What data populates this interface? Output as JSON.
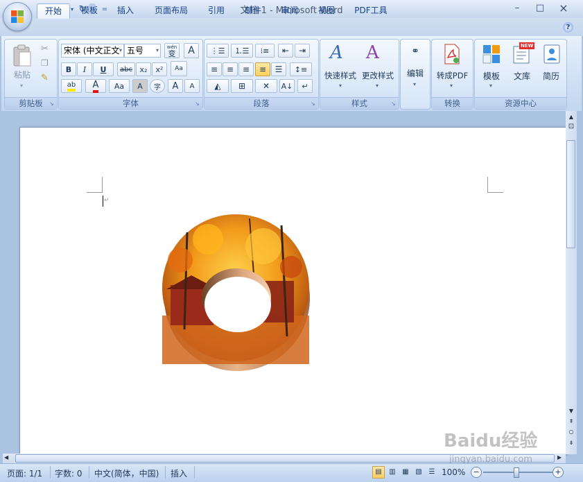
{
  "window": {
    "title": "文档 1 - Microsoft Word",
    "buttons": {
      "minimize": "–",
      "maximize": "□",
      "close": "×"
    }
  },
  "quick_access": {
    "more": "="
  },
  "tabs": [
    {
      "label": "开始",
      "active": true
    },
    {
      "label": "模板"
    },
    {
      "label": "插入"
    },
    {
      "label": "页面布局"
    },
    {
      "label": "引用"
    },
    {
      "label": "邮件"
    },
    {
      "label": "审阅"
    },
    {
      "label": "视图"
    },
    {
      "label": "PDF工具"
    }
  ],
  "help_icon": "?",
  "ribbon": {
    "clipboard": {
      "label": "剪贴板",
      "paste": "粘贴"
    },
    "font": {
      "label": "字体",
      "font_name": "宋体 (中文正文",
      "font_size": "五号",
      "wen": "wén",
      "wen_char": "变",
      "A_box": "A",
      "bold": "B",
      "italic": "I",
      "underline": "U",
      "strike": "abc",
      "sub": "x₂",
      "sup": "x²",
      "clear": "Aa",
      "highlight": "ab",
      "color": "A",
      "case": "Aa",
      "shade": "A",
      "enclose": "字",
      "grow": "A",
      "shrink": "A"
    },
    "paragraph": {
      "label": "段落"
    },
    "styles": {
      "label": "样式",
      "quick_styles": "快速样式",
      "change_styles": "更改样式"
    },
    "editing": {
      "label": "编辑"
    },
    "convert": {
      "label": "转换",
      "to_pdf": "转成PDF"
    },
    "resources": {
      "label": "资源中心",
      "template": "模板",
      "library": "文库",
      "resume": "简历",
      "new_badge": "NEW"
    }
  },
  "status": {
    "page": "页面: 1/1",
    "words": "字数: 0",
    "language": "中文(简体，中国)",
    "mode": "插入",
    "zoom": "100%"
  },
  "watermark": {
    "logo": "Baidu经验",
    "url": "jingyan.baidu.com"
  },
  "colors": {
    "accent": "#15428b",
    "ribbon": "#dbe8f8",
    "page": "#ffffff",
    "workspace": "#aac3e0"
  }
}
